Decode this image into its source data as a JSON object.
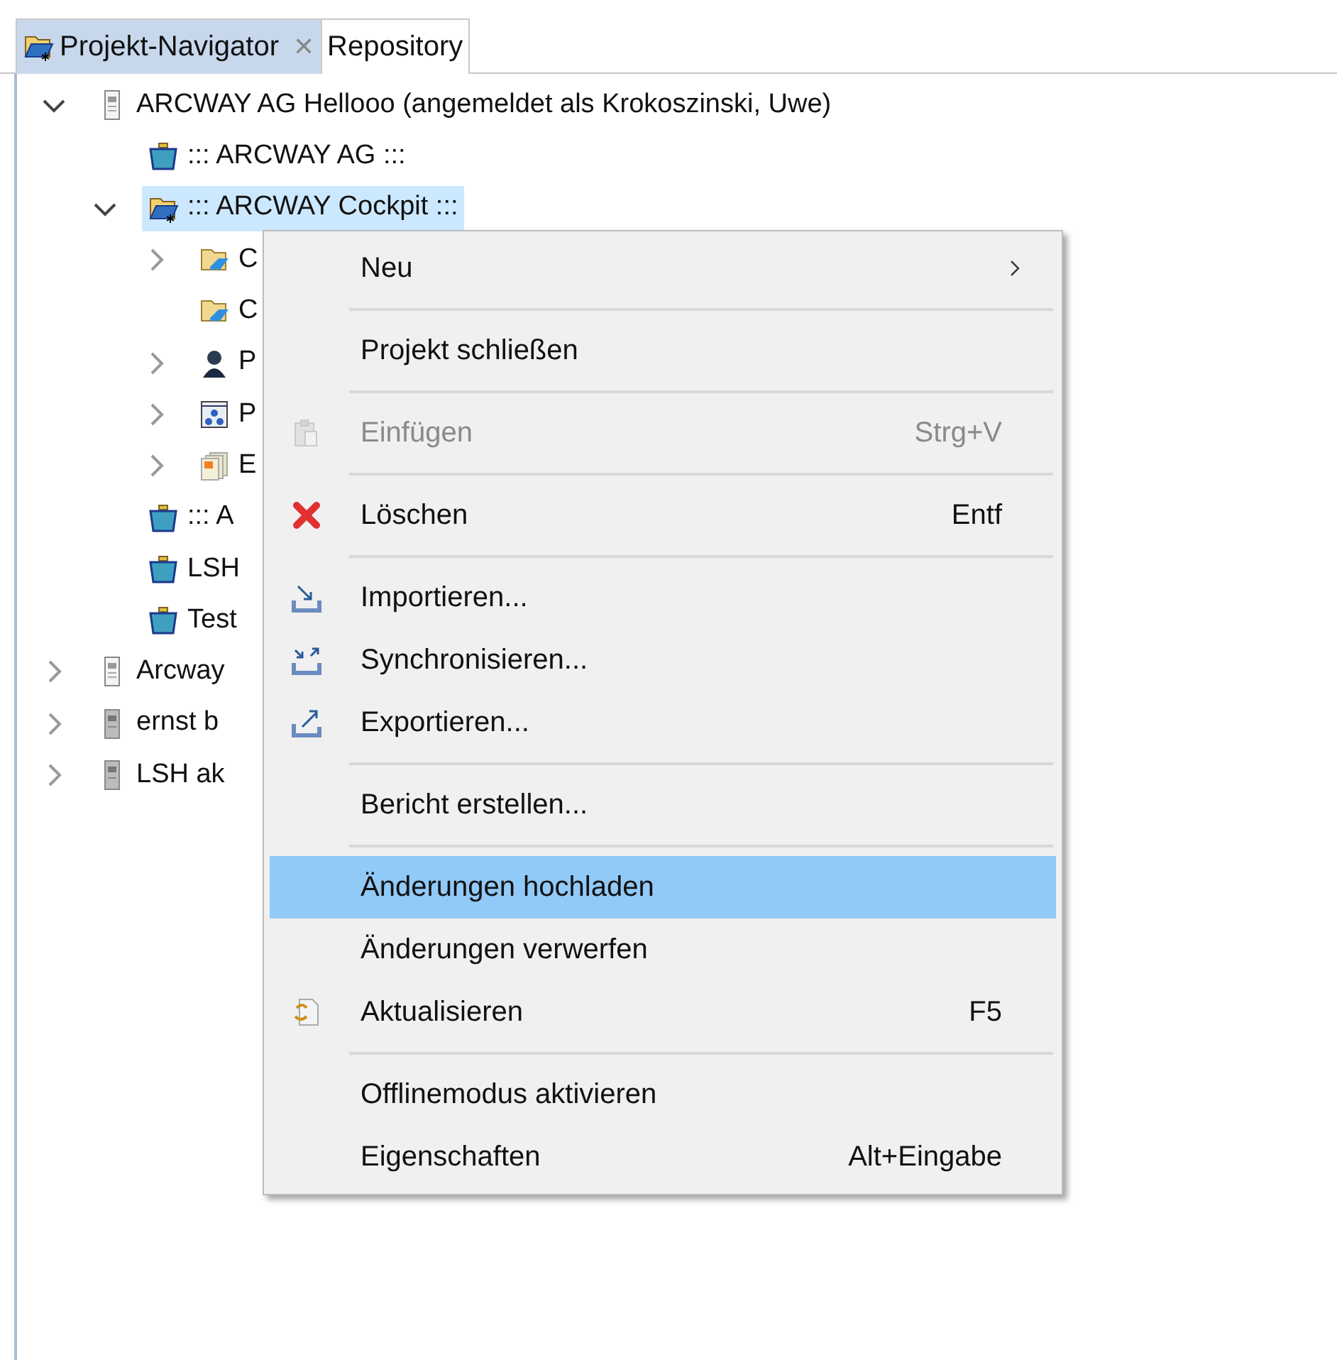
{
  "tabs": [
    {
      "label": "Projekt-Navigator",
      "selected": true,
      "close": "✕"
    },
    {
      "label": "Repository",
      "selected": false
    }
  ],
  "tree": [
    {
      "label": "ARCWAY AG Hellooo (angemeldet als Krokoszinski, Uwe)",
      "kind": "server",
      "expanded": true,
      "selected": false,
      "children": [
        {
          "label": "::: ARCWAY AG :::",
          "kind": "project",
          "selected": false
        },
        {
          "label": "::: ARCWAY Cockpit :::",
          "kind": "open-project",
          "expanded": true,
          "selected": true,
          "children": [
            {
              "label": "C",
              "kind": "shared",
              "expanded": false,
              "selected": false
            },
            {
              "label": "C",
              "kind": "shared",
              "selected": false
            },
            {
              "label": "P",
              "kind": "user",
              "expanded": false,
              "selected": false
            },
            {
              "label": "P",
              "kind": "diagram",
              "expanded": false,
              "selected": false
            },
            {
              "label": "E",
              "kind": "documents",
              "expanded": false,
              "selected": false
            }
          ]
        },
        {
          "label": "::: A",
          "kind": "project",
          "selected": false
        },
        {
          "label": "LSH",
          "kind": "project",
          "selected": false
        },
        {
          "label": "Test",
          "kind": "project",
          "selected": false
        }
      ]
    },
    {
      "label": "Arcway",
      "kind": "server",
      "expanded": false,
      "selected": false
    },
    {
      "label": "ernst b",
      "kind": "offline-server",
      "expanded": false,
      "selected": false
    },
    {
      "label": "LSH ak",
      "kind": "offline-server",
      "expanded": false,
      "selected": false
    }
  ],
  "context_menu": [
    {
      "kind": "submenu",
      "label": "Neu",
      "disabled": false,
      "selected": false
    },
    {
      "kind": "separator"
    },
    {
      "kind": "plain",
      "label": "Projekt schließen",
      "disabled": false,
      "selected": false
    },
    {
      "kind": "separator"
    },
    {
      "kind": "clipboard",
      "label": "Einfügen",
      "shortcut": "Strg+V",
      "disabled": true,
      "selected": false
    },
    {
      "kind": "separator"
    },
    {
      "kind": "delete",
      "label": "Löschen",
      "shortcut": "Entf",
      "disabled": false,
      "selected": false
    },
    {
      "kind": "separator"
    },
    {
      "kind": "import",
      "label": "Importieren...",
      "disabled": false,
      "selected": false
    },
    {
      "kind": "sync",
      "label": "Synchronisieren...",
      "disabled": false,
      "selected": false
    },
    {
      "kind": "export",
      "label": "Exportieren...",
      "disabled": false,
      "selected": false
    },
    {
      "kind": "separator"
    },
    {
      "kind": "plain",
      "label": "Bericht erstellen...",
      "disabled": false,
      "selected": false
    },
    {
      "kind": "separator"
    },
    {
      "kind": "plain",
      "label": "Änderungen hochladen",
      "disabled": false,
      "selected": true
    },
    {
      "kind": "plain",
      "label": "Änderungen verwerfen",
      "disabled": false,
      "selected": false
    },
    {
      "kind": "refresh",
      "label": "Aktualisieren",
      "shortcut": "F5",
      "disabled": false,
      "selected": false
    },
    {
      "kind": "separator"
    },
    {
      "kind": "plain",
      "label": "Offlinemodus aktivieren",
      "disabled": false,
      "selected": false
    },
    {
      "kind": "plain",
      "label": "Eigenschaften",
      "shortcut": "Alt+Eingabe",
      "disabled": false,
      "selected": false
    }
  ]
}
